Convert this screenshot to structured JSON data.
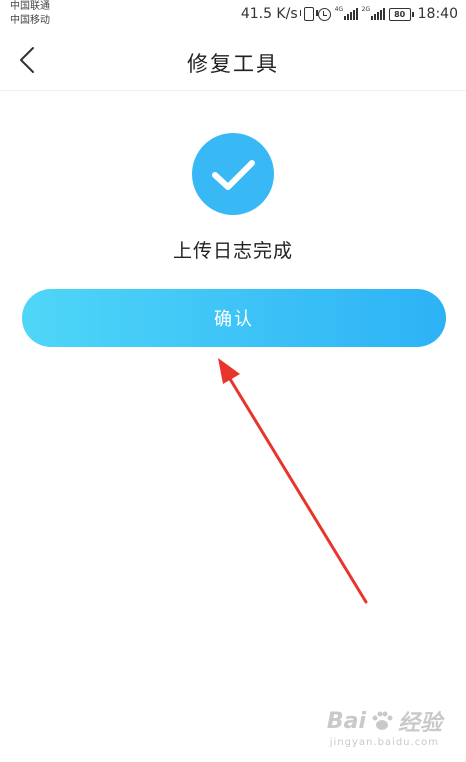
{
  "status_bar": {
    "carrier_1": "中国联通",
    "carrier_2": "中国移动",
    "net_speed": "41.5 K/s",
    "signal_1_tag": "4G",
    "signal_2_tag": "2G",
    "battery": "80",
    "time": "18:40",
    "icons": [
      "vibrate-icon",
      "alarm-icon",
      "signal-icon",
      "signal-icon",
      "battery-icon"
    ]
  },
  "header": {
    "title": "修复工具",
    "back_icon": "chevron-left-icon"
  },
  "result": {
    "icon": "checkmark-icon",
    "message": "上传日志完成"
  },
  "actions": {
    "confirm_label": "确认"
  },
  "watermark": {
    "brand_left": "Bai",
    "brand_right": "经验",
    "url": "jingyan.baidu.com"
  },
  "colors": {
    "accent": "#38b8f5",
    "button_start": "#4fd6f7",
    "button_end": "#2db2f6",
    "annotation_arrow": "#e8342a"
  }
}
